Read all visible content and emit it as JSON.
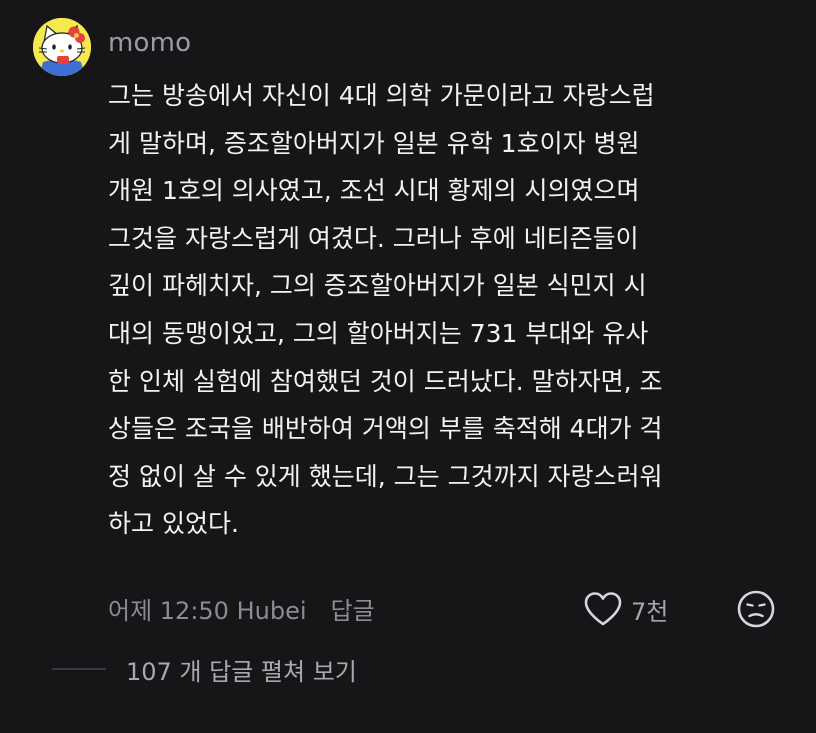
{
  "comment": {
    "username": "momo",
    "text_lines": [
      "그는 방송에서 자신이 4대 의학 가문이라고 자랑스럽",
      "게 말하며, 증조할아버지가 일본 유학 1호이자 병원",
      "개원 1호의 의사였고, 조선 시대 황제의 시의였으며",
      "그것을 자랑스럽게 여겼다. 그러나 후에 네티즌들이",
      "깊이 파헤치자, 그의 증조할아버지가 일본 식민지 시",
      "대의 동맹이었고, 그의 할아버지는 731 부대와 유사",
      "한 인체 실험에 참여했던 것이 드러났다. 말하자면, 조",
      "상들은 조국을 배반하여 거액의 부를 축적해 4대가 걱",
      "정 없이 살 수 있게 했는데, 그는 그것까지 자랑스러워",
      "하고 있었다."
    ],
    "meta_time": "어제 12:50 Hubei",
    "reply_label": "답글",
    "like_count": "7천",
    "avatar_icon": "hello-kitty-avatar",
    "like_icon": "heart-outline-icon",
    "reaction_icon": "sad-face-icon"
  },
  "replies": {
    "expand_label": "107 개 답글 펼쳐 보기"
  },
  "colors": {
    "background": "#161618",
    "text": "#f2f2f2",
    "secondary_text": "#8c8c90",
    "avatar_bg": "#f6e94f"
  }
}
